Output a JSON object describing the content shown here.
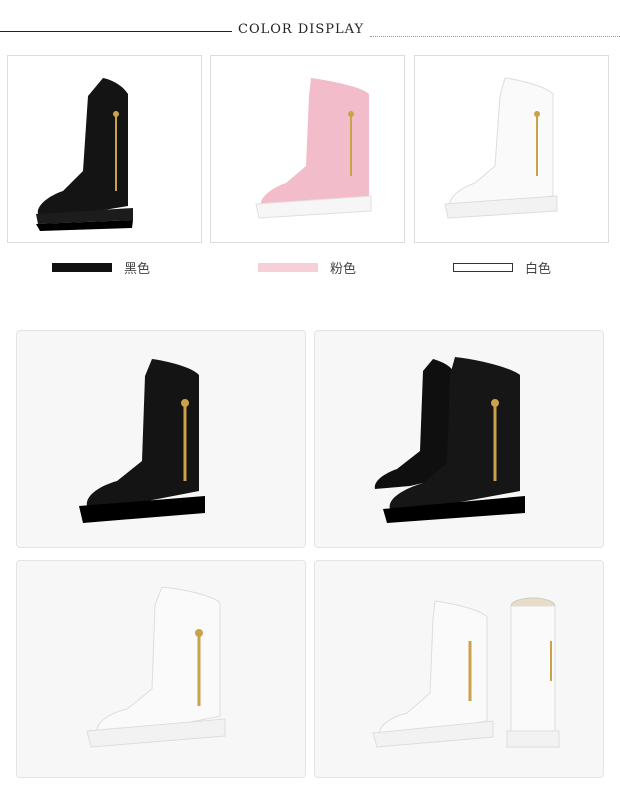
{
  "header": {
    "title": "COLOR DISPLAY"
  },
  "swatches": [
    {
      "label": "黑色",
      "color": "#111111",
      "boot_color": "black"
    },
    {
      "label": "粉色",
      "color": "#f6cfd8",
      "boot_color": "pink"
    },
    {
      "label": "白色",
      "color": "#ffffff",
      "boot_color": "white"
    }
  ],
  "colors": {
    "black_boot": "#141414",
    "pink_boot": "#f3bccb",
    "white_boot": "#fafafa",
    "zipper_gold": "#c9a24a",
    "sole_white": "#f2f2f2"
  }
}
